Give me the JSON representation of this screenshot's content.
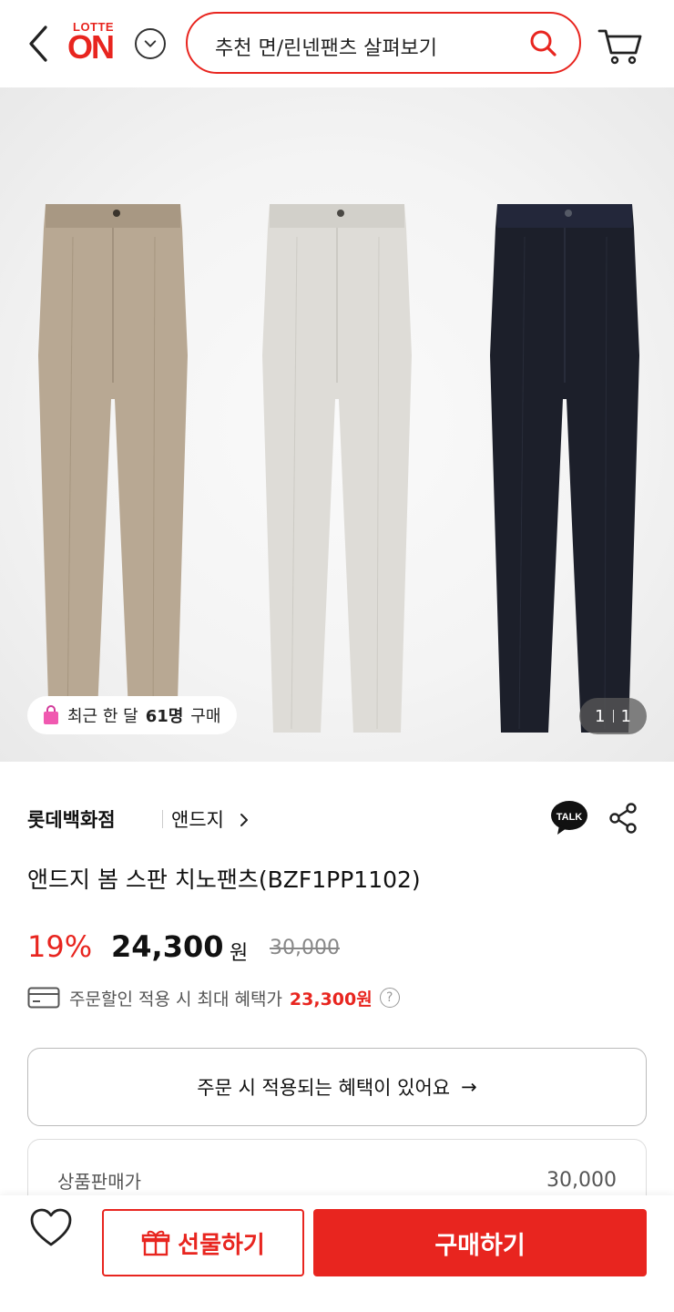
{
  "header": {
    "logo_top": "LOTTE",
    "logo_main": "ON",
    "search_text": "추천 면/린넨팬츠 살펴보기"
  },
  "hero": {
    "badge_prefix": "최근 한 달",
    "badge_count": "61명",
    "badge_suffix": "구매",
    "pager_current": "1",
    "pager_total": "1",
    "pants_colors": [
      "#b8a893",
      "#dedcd7",
      "#1c1f2a"
    ]
  },
  "product": {
    "store": "롯데백화점",
    "brand": "앤드지",
    "talk_label": "TALK",
    "title": "앤드지 봄 스판 치노팬츠(BZF1PP1102)",
    "discount": "19%",
    "price": "24,300",
    "currency": "원",
    "original_price": "30,000",
    "benefit_text": "주문할인 적용 시 최대 혜택가",
    "benefit_price": "23,300원",
    "benefit_help": "?"
  },
  "benefit_button": {
    "label": "주문 시 적용되는 혜택이 있어요",
    "arrow": "→"
  },
  "price_table": {
    "label": "상품판매가",
    "value": "30,000"
  },
  "bottom_bar": {
    "gift_label": "선물하기",
    "buy_label": "구매하기"
  },
  "colors": {
    "accent": "#e8251f"
  }
}
